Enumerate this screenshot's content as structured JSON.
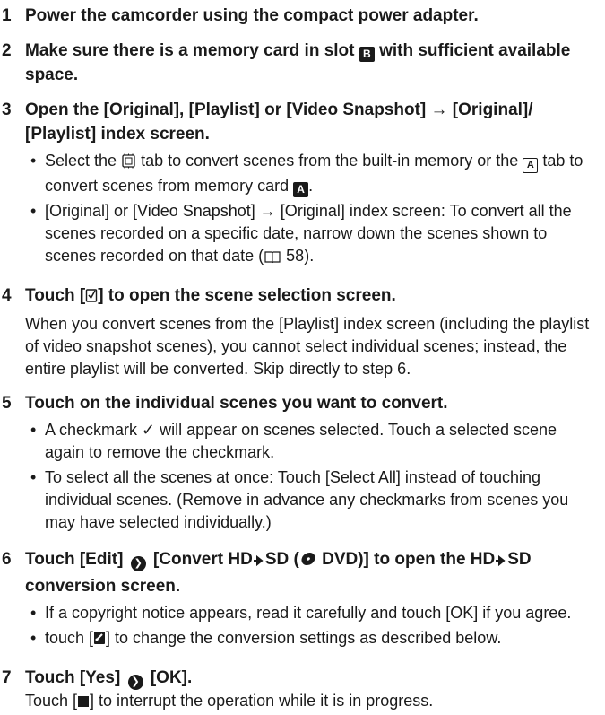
{
  "steps": [
    {
      "num": "1",
      "title": "Power the camcorder using the compact power adapter."
    },
    {
      "num": "2",
      "title_a": "Make sure there is a memory card in slot",
      "slot": "B",
      "title_b": "with sufficient available space."
    },
    {
      "num": "3",
      "title": "Open the [Original], [Playlist] or [Video Snapshot] → [Original]/ [Playlist] index screen.",
      "bullets": [
        {
          "a": "Select the",
          "b": "tab to convert scenes from the built-in memory or the",
          "card_letter": "A",
          "c": "tab to convert scenes from memory card",
          "card_letter_dark": "A",
          "d": "."
        },
        {
          "text": "[Original] or [Video Snapshot] → [Original] index screen: To convert all the scenes recorded on a specific date, narrow down the scenes shown to scenes recorded on that date (",
          "page": "58",
          "end": ")."
        }
      ]
    },
    {
      "num": "4",
      "title_a": "Touch [",
      "title_b": "] to open the scene selection screen.",
      "text": "When you convert scenes from the [Playlist] index screen (including the playlist of video snapshot scenes), you cannot select individual scenes; instead, the entire playlist will be converted. Skip directly to step 6."
    },
    {
      "num": "5",
      "title": "Touch on the individual scenes you want to convert.",
      "bullets": [
        "A checkmark ✓ will appear on scenes selected. Touch a selected scene again to remove the checkmark.",
        "To select all the scenes at once: Touch [Select All] instead of touching individual scenes. (Remove in advance any checkmarks from scenes you may have selected individually.)"
      ]
    },
    {
      "num": "6",
      "title_a": "Touch [Edit]",
      "title_b": "[Convert HD",
      "title_c": "SD (",
      "title_d": "DVD)] to open the HD",
      "title_e": "SD conversion screen.",
      "bullets": [
        "If a copyright notice appears, read it carefully and touch [OK] if you agree.",
        "touch [",
        "] to change the conversion settings as described below."
      ]
    },
    {
      "num": "7",
      "title_a": "Touch [Yes]",
      "title_b": "[OK].",
      "text_a": "Touch [",
      "text_b": "] to interrupt the operation while it is in progress."
    }
  ],
  "bullet_char": "•",
  "colors": {
    "text": "#1a1a1a",
    "background": "#ffffff"
  },
  "icons": {
    "step3_memory": "built-in-memory-icon",
    "step4_touch": "select-scenes-icon",
    "step6_arrow": "menu-arrow-icon",
    "step6_disc": "dvd-disc-icon",
    "step6_settings": "settings-icon",
    "step7_stop": "stop-icon"
  }
}
